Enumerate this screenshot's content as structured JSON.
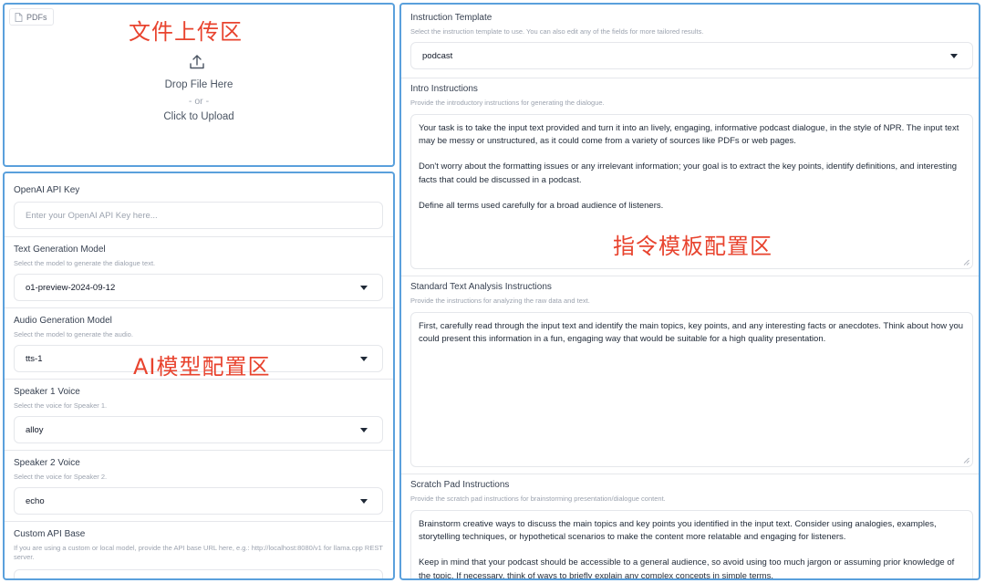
{
  "upload": {
    "tag_label": "PDFs",
    "annotation": "文件上传区",
    "drop_text": "Drop File Here",
    "or_text": "- or -",
    "click_text": "Click to Upload"
  },
  "model_config": {
    "annotation": "AI模型配置区",
    "api_key": {
      "label": "OpenAI API Key",
      "placeholder": "Enter your OpenAI API Key here..."
    },
    "text_model": {
      "label": "Text Generation Model",
      "description": "Select the model to generate the dialogue text.",
      "value": "o1-preview-2024-09-12"
    },
    "audio_model": {
      "label": "Audio Generation Model",
      "description": "Select the model to generate the audio.",
      "value": "tts-1"
    },
    "speaker1": {
      "label": "Speaker 1 Voice",
      "description": "Select the voice for Speaker 1.",
      "value": "alloy"
    },
    "speaker2": {
      "label": "Speaker 2 Voice",
      "description": "Select the voice for Speaker 2.",
      "value": "echo"
    },
    "api_base": {
      "label": "Custom API Base",
      "description": "If you are using a custom or local model, provide the API base URL here, e.g.: http://localhost:8080/v1 for llama.cpp REST server."
    }
  },
  "template_config": {
    "annotation": "指令模板配置区",
    "instruction_template": {
      "label": "Instruction Template",
      "description": "Select the instruction template to use. You can also edit any of the fields for more tailored results.",
      "value": "podcast"
    },
    "intro": {
      "label": "Intro Instructions",
      "description": "Provide the introductory instructions for generating the dialogue.",
      "paragraphs": [
        "Your task is to take the input text provided and turn it into an lively, engaging, informative podcast dialogue, in the style of NPR. The input text may be messy or unstructured, as it could come from a variety of sources like PDFs or web pages.",
        "Don't worry about the formatting issues or any irrelevant information; your goal is to extract the key points, identify definitions, and interesting facts that could be discussed in a podcast.",
        "Define all terms used carefully for a broad audience of listeners."
      ]
    },
    "analysis": {
      "label": "Standard Text Analysis Instructions",
      "description": "Provide the instructions for analyzing the raw data and text.",
      "paragraphs": [
        "First, carefully read through the input text and identify the main topics, key points, and any interesting facts or anecdotes. Think about how you could present this information in a fun, engaging way that would be suitable for a high quality presentation."
      ]
    },
    "scratch": {
      "label": "Scratch Pad Instructions",
      "description": "Provide the scratch pad instructions for brainstorming presentation/dialogue content.",
      "paragraphs": [
        "Brainstorm creative ways to discuss the main topics and key points you identified in the input text. Consider using analogies, examples, storytelling techniques, or hypothetical scenarios to make the content more relatable and engaging for listeners.",
        "Keep in mind that your podcast should be accessible to a general audience, so avoid using too much jargon or assuming prior knowledge of the topic. If necessary, think of ways to briefly explain any complex concepts in simple terms."
      ]
    }
  }
}
